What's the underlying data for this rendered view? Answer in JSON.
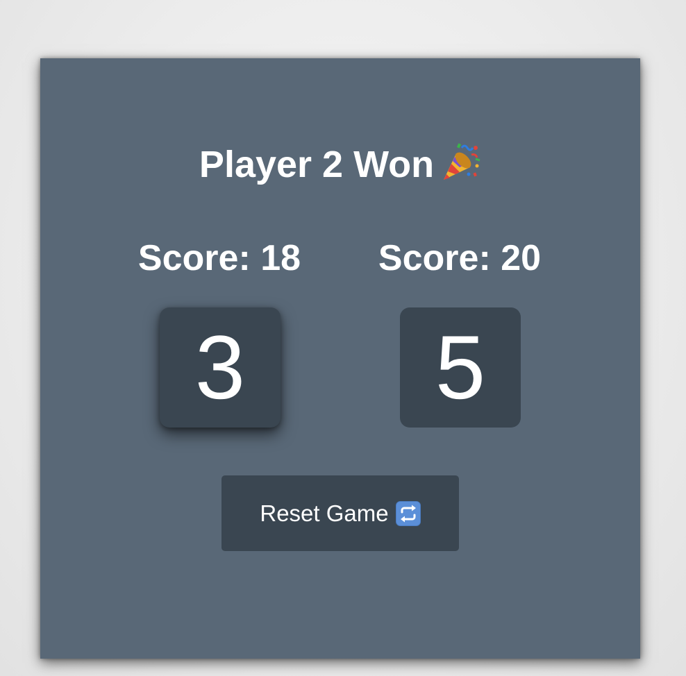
{
  "header": {
    "title": "Player 2 Won",
    "title_emoji_icon": "party-popper-icon"
  },
  "players": [
    {
      "score_label": "Score: 18",
      "die_value": "3",
      "active": true
    },
    {
      "score_label": "Score: 20",
      "die_value": "5",
      "active": false
    }
  ],
  "controls": {
    "reset_label": "Reset Game",
    "reset_icon": "repeat-icon"
  },
  "colors": {
    "card_bg": "#596877",
    "die_bg": "#3a4651",
    "text": "#ffffff"
  }
}
